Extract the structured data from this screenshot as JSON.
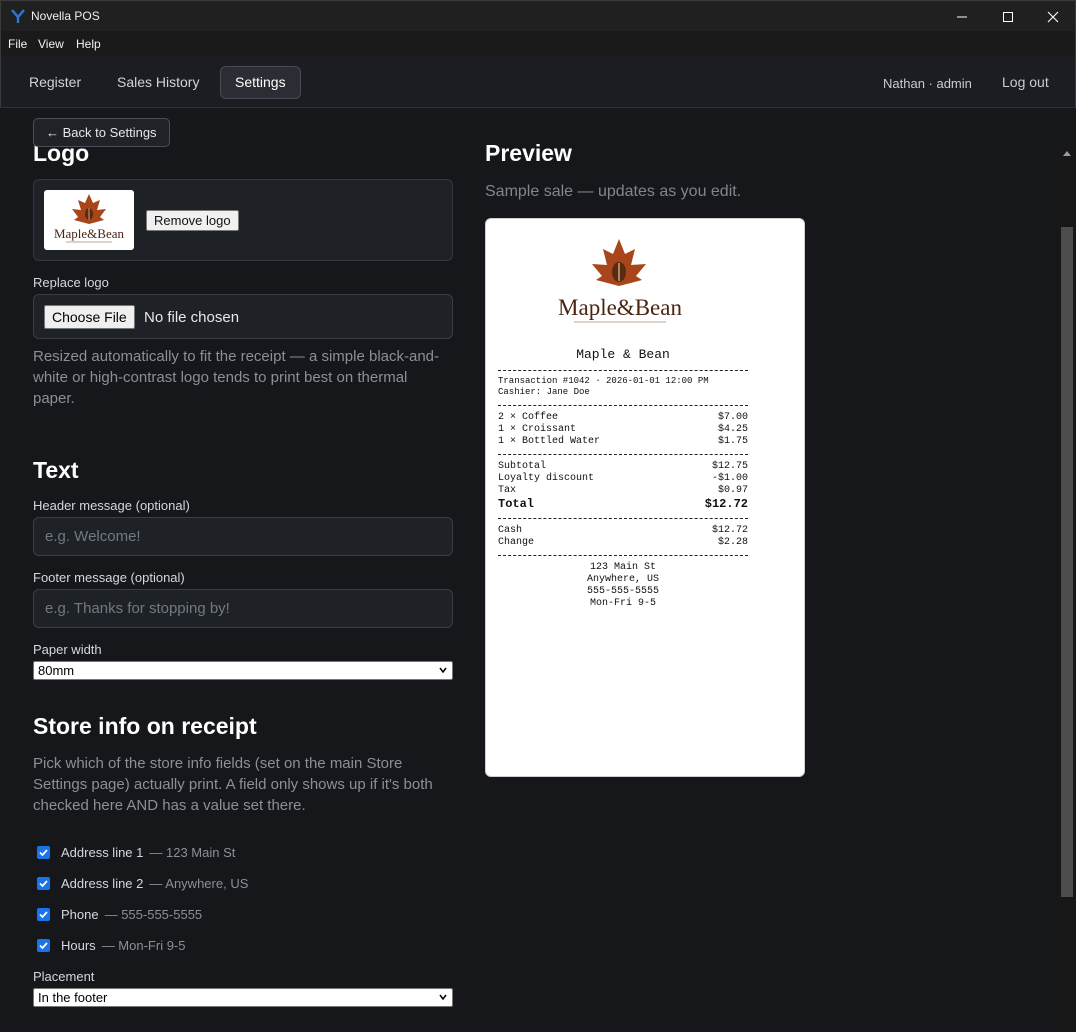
{
  "window": {
    "title": "Novella POS"
  },
  "menu": {
    "items": [
      "File",
      "View",
      "Help"
    ]
  },
  "nav": {
    "tabs": [
      "Register",
      "Sales History",
      "Settings"
    ],
    "user": "Nathan · admin",
    "logout": "Log out"
  },
  "back_button": "← Back to Settings",
  "logo_section": {
    "heading": "Logo",
    "remove_label": "Remove logo",
    "replace_label": "Replace logo",
    "choose_file": "Choose File",
    "no_file": "No file chosen",
    "help": "Resized automatically to fit the receipt — a simple black-and-white or high-contrast logo tends to print best on thermal paper.",
    "logo_text": "Maple&Bean"
  },
  "text_section": {
    "heading": "Text",
    "header_label": "Header message (optional)",
    "header_placeholder": "e.g. Welcome!",
    "footer_label": "Footer message (optional)",
    "footer_placeholder": "e.g. Thanks for stopping by!",
    "paper_width_label": "Paper width",
    "paper_width_value": "80mm"
  },
  "store_info_section": {
    "heading": "Store info on receipt",
    "help": "Pick which of the store info fields (set on the main Store Settings page) actually print. A field only shows up if it's both checked here AND has a value set there.",
    "fields": [
      {
        "label": "Address line 1",
        "value": "— 123 Main St",
        "checked": true
      },
      {
        "label": "Address line 2",
        "value": "— Anywhere, US",
        "checked": true
      },
      {
        "label": "Phone",
        "value": "— 555-555-5555",
        "checked": true
      },
      {
        "label": "Hours",
        "value": "— Mon-Fri 9-5",
        "checked": true
      }
    ],
    "placement_label": "Placement",
    "placement_value": "In the footer"
  },
  "preview": {
    "heading": "Preview",
    "subtitle": "Sample sale — updates as you edit.",
    "receipt": {
      "logo_text": "Maple&Bean",
      "store_name": "Maple & Bean",
      "transaction": "Transaction #1042 · 2026-01-01 12:00 PM",
      "cashier": "Cashier: Jane Doe",
      "items": [
        {
          "desc": "2 × Coffee",
          "amount": "$7.00"
        },
        {
          "desc": "1 × Croissant",
          "amount": "$4.25"
        },
        {
          "desc": "1 × Bottled Water",
          "amount": "$1.75"
        }
      ],
      "subtotal_label": "Subtotal",
      "subtotal": "$12.75",
      "discount_label": "Loyalty discount",
      "discount": "-$1.00",
      "tax_label": "Tax",
      "tax": "$0.97",
      "total_label": "Total",
      "total": "$12.72",
      "cash_label": "Cash",
      "cash": "$12.72",
      "change_label": "Change",
      "change": "$2.28",
      "footer_lines": [
        "123 Main St",
        "Anywhere, US",
        "555-555-5555",
        "Mon-Fri 9-5"
      ]
    }
  },
  "colors": {
    "accent": "#1a73e8",
    "logo_brown": "#8b3a14"
  }
}
